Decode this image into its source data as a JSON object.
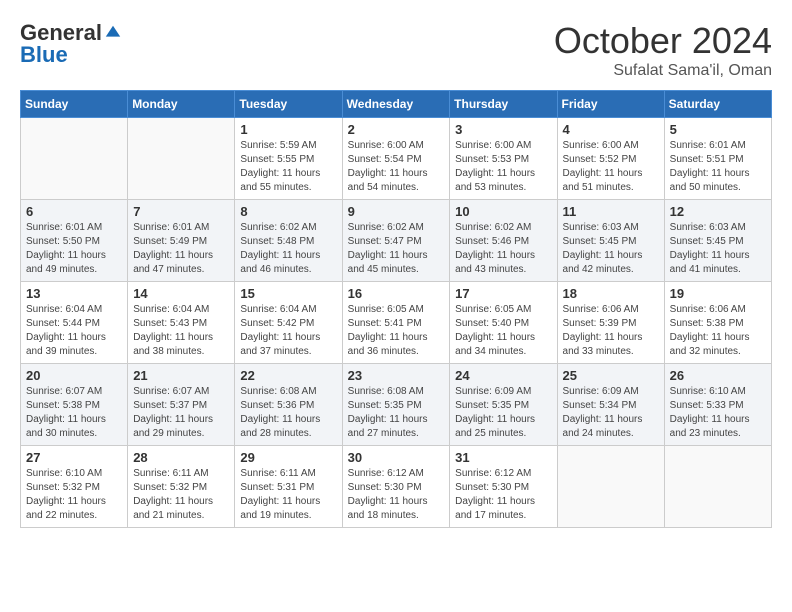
{
  "logo": {
    "general": "General",
    "blue": "Blue"
  },
  "title": "October 2024",
  "location": "Sufalat Sama'il, Oman",
  "days_of_week": [
    "Sunday",
    "Monday",
    "Tuesday",
    "Wednesday",
    "Thursday",
    "Friday",
    "Saturday"
  ],
  "weeks": [
    [
      {
        "day": "",
        "info": ""
      },
      {
        "day": "",
        "info": ""
      },
      {
        "day": "1",
        "sunrise": "Sunrise: 5:59 AM",
        "sunset": "Sunset: 5:55 PM",
        "daylight": "Daylight: 11 hours and 55 minutes."
      },
      {
        "day": "2",
        "sunrise": "Sunrise: 6:00 AM",
        "sunset": "Sunset: 5:54 PM",
        "daylight": "Daylight: 11 hours and 54 minutes."
      },
      {
        "day": "3",
        "sunrise": "Sunrise: 6:00 AM",
        "sunset": "Sunset: 5:53 PM",
        "daylight": "Daylight: 11 hours and 53 minutes."
      },
      {
        "day": "4",
        "sunrise": "Sunrise: 6:00 AM",
        "sunset": "Sunset: 5:52 PM",
        "daylight": "Daylight: 11 hours and 51 minutes."
      },
      {
        "day": "5",
        "sunrise": "Sunrise: 6:01 AM",
        "sunset": "Sunset: 5:51 PM",
        "daylight": "Daylight: 11 hours and 50 minutes."
      }
    ],
    [
      {
        "day": "6",
        "sunrise": "Sunrise: 6:01 AM",
        "sunset": "Sunset: 5:50 PM",
        "daylight": "Daylight: 11 hours and 49 minutes."
      },
      {
        "day": "7",
        "sunrise": "Sunrise: 6:01 AM",
        "sunset": "Sunset: 5:49 PM",
        "daylight": "Daylight: 11 hours and 47 minutes."
      },
      {
        "day": "8",
        "sunrise": "Sunrise: 6:02 AM",
        "sunset": "Sunset: 5:48 PM",
        "daylight": "Daylight: 11 hours and 46 minutes."
      },
      {
        "day": "9",
        "sunrise": "Sunrise: 6:02 AM",
        "sunset": "Sunset: 5:47 PM",
        "daylight": "Daylight: 11 hours and 45 minutes."
      },
      {
        "day": "10",
        "sunrise": "Sunrise: 6:02 AM",
        "sunset": "Sunset: 5:46 PM",
        "daylight": "Daylight: 11 hours and 43 minutes."
      },
      {
        "day": "11",
        "sunrise": "Sunrise: 6:03 AM",
        "sunset": "Sunset: 5:45 PM",
        "daylight": "Daylight: 11 hours and 42 minutes."
      },
      {
        "day": "12",
        "sunrise": "Sunrise: 6:03 AM",
        "sunset": "Sunset: 5:45 PM",
        "daylight": "Daylight: 11 hours and 41 minutes."
      }
    ],
    [
      {
        "day": "13",
        "sunrise": "Sunrise: 6:04 AM",
        "sunset": "Sunset: 5:44 PM",
        "daylight": "Daylight: 11 hours and 39 minutes."
      },
      {
        "day": "14",
        "sunrise": "Sunrise: 6:04 AM",
        "sunset": "Sunset: 5:43 PM",
        "daylight": "Daylight: 11 hours and 38 minutes."
      },
      {
        "day": "15",
        "sunrise": "Sunrise: 6:04 AM",
        "sunset": "Sunset: 5:42 PM",
        "daylight": "Daylight: 11 hours and 37 minutes."
      },
      {
        "day": "16",
        "sunrise": "Sunrise: 6:05 AM",
        "sunset": "Sunset: 5:41 PM",
        "daylight": "Daylight: 11 hours and 36 minutes."
      },
      {
        "day": "17",
        "sunrise": "Sunrise: 6:05 AM",
        "sunset": "Sunset: 5:40 PM",
        "daylight": "Daylight: 11 hours and 34 minutes."
      },
      {
        "day": "18",
        "sunrise": "Sunrise: 6:06 AM",
        "sunset": "Sunset: 5:39 PM",
        "daylight": "Daylight: 11 hours and 33 minutes."
      },
      {
        "day": "19",
        "sunrise": "Sunrise: 6:06 AM",
        "sunset": "Sunset: 5:38 PM",
        "daylight": "Daylight: 11 hours and 32 minutes."
      }
    ],
    [
      {
        "day": "20",
        "sunrise": "Sunrise: 6:07 AM",
        "sunset": "Sunset: 5:38 PM",
        "daylight": "Daylight: 11 hours and 30 minutes."
      },
      {
        "day": "21",
        "sunrise": "Sunrise: 6:07 AM",
        "sunset": "Sunset: 5:37 PM",
        "daylight": "Daylight: 11 hours and 29 minutes."
      },
      {
        "day": "22",
        "sunrise": "Sunrise: 6:08 AM",
        "sunset": "Sunset: 5:36 PM",
        "daylight": "Daylight: 11 hours and 28 minutes."
      },
      {
        "day": "23",
        "sunrise": "Sunrise: 6:08 AM",
        "sunset": "Sunset: 5:35 PM",
        "daylight": "Daylight: 11 hours and 27 minutes."
      },
      {
        "day": "24",
        "sunrise": "Sunrise: 6:09 AM",
        "sunset": "Sunset: 5:35 PM",
        "daylight": "Daylight: 11 hours and 25 minutes."
      },
      {
        "day": "25",
        "sunrise": "Sunrise: 6:09 AM",
        "sunset": "Sunset: 5:34 PM",
        "daylight": "Daylight: 11 hours and 24 minutes."
      },
      {
        "day": "26",
        "sunrise": "Sunrise: 6:10 AM",
        "sunset": "Sunset: 5:33 PM",
        "daylight": "Daylight: 11 hours and 23 minutes."
      }
    ],
    [
      {
        "day": "27",
        "sunrise": "Sunrise: 6:10 AM",
        "sunset": "Sunset: 5:32 PM",
        "daylight": "Daylight: 11 hours and 22 minutes."
      },
      {
        "day": "28",
        "sunrise": "Sunrise: 6:11 AM",
        "sunset": "Sunset: 5:32 PM",
        "daylight": "Daylight: 11 hours and 21 minutes."
      },
      {
        "day": "29",
        "sunrise": "Sunrise: 6:11 AM",
        "sunset": "Sunset: 5:31 PM",
        "daylight": "Daylight: 11 hours and 19 minutes."
      },
      {
        "day": "30",
        "sunrise": "Sunrise: 6:12 AM",
        "sunset": "Sunset: 5:30 PM",
        "daylight": "Daylight: 11 hours and 18 minutes."
      },
      {
        "day": "31",
        "sunrise": "Sunrise: 6:12 AM",
        "sunset": "Sunset: 5:30 PM",
        "daylight": "Daylight: 11 hours and 17 minutes."
      },
      {
        "day": "",
        "info": ""
      },
      {
        "day": "",
        "info": ""
      }
    ]
  ]
}
